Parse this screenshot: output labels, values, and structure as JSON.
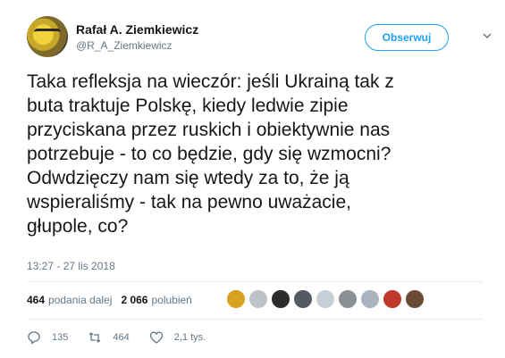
{
  "user": {
    "name": "Rafał A. Ziemkiewicz",
    "handle": "@R_A_Ziemkiewicz"
  },
  "follow_button": {
    "label": "Obserwuj"
  },
  "tweet": {
    "text": "Taka refleksja na wieczór: jeśli Ukrainą tak z\nbuta traktuje Polskę, kiedy ledwie zipie\nprzyciskana przez ruskich i obiektywnie nas\npotrzebuje - to co będzie, gdy się wzmocni?\nOdwdzięczy nam się wtedy za to, że ją\nwspieraliśmy - tak na pewno uważacie,\ngłupole, co?",
    "timestamp": "13:27 - 27 lis 2018"
  },
  "stats": {
    "retweets_count": "464",
    "retweets_label": "podania dalej",
    "likes_count": "2 066",
    "likes_label": "polubień"
  },
  "likers": [
    {
      "icon": "liker-avatar-1",
      "color": "#d9a21e"
    },
    {
      "icon": "liker-avatar-2",
      "color": "#bfc3c7"
    },
    {
      "icon": "liker-avatar-3",
      "color": "#2b2b2b"
    },
    {
      "icon": "liker-avatar-4",
      "color": "#555a60"
    },
    {
      "icon": "liker-avatar-5",
      "color": "#c7cfd6"
    },
    {
      "icon": "liker-avatar-6",
      "color": "#8c8f93"
    },
    {
      "icon": "liker-avatar-7",
      "color": "#a9b3bd"
    },
    {
      "icon": "liker-avatar-8",
      "color": "#c0392b"
    },
    {
      "icon": "liker-avatar-9",
      "color": "#6b4a35"
    }
  ],
  "actions": {
    "reply_count": "135",
    "retweet_count": "464",
    "like_count": "2,1 tys."
  },
  "colors": {
    "accent": "#1da1f2",
    "secondary_text": "#657786",
    "divider": "#e6ecf0"
  }
}
